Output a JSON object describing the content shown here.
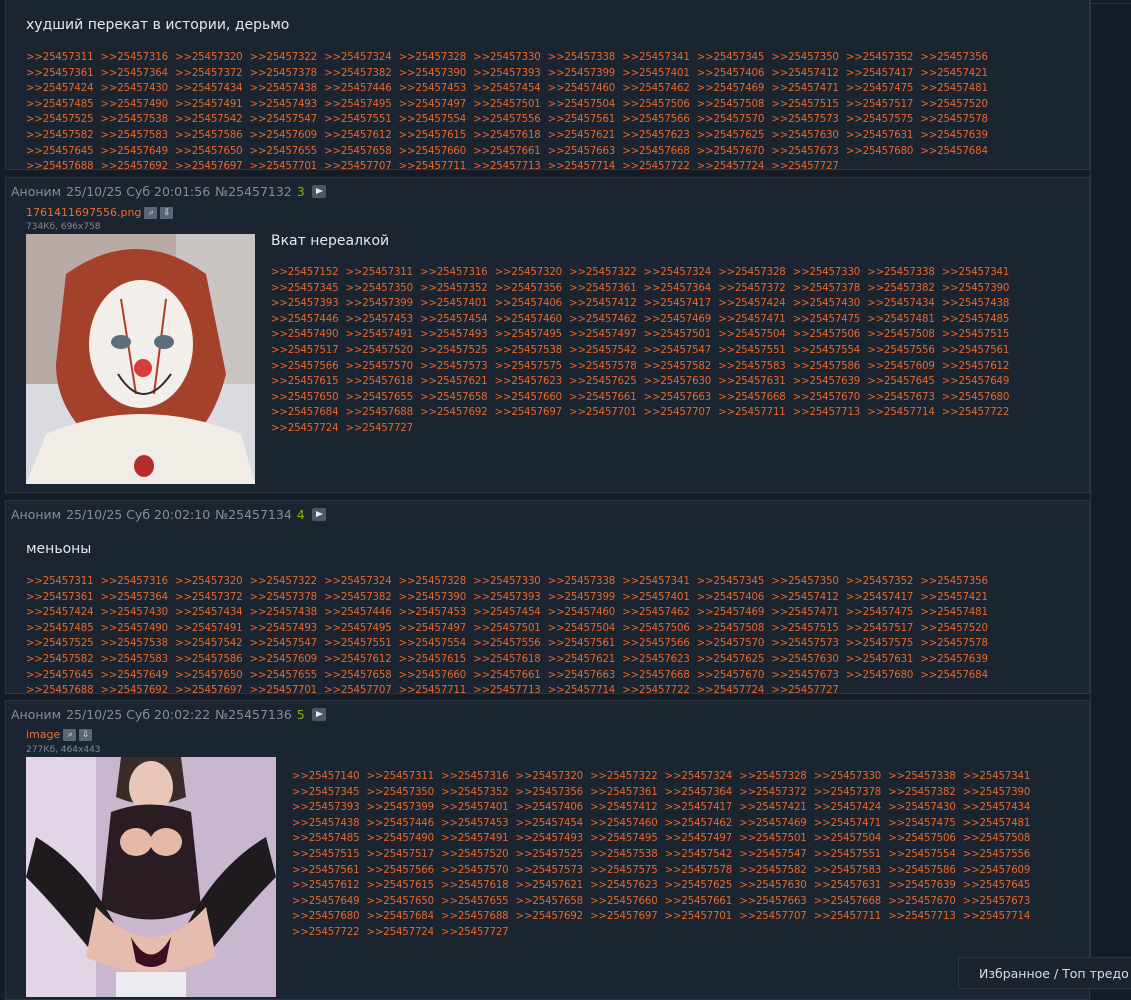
{
  "posts": [
    {
      "title": "худший перекат в истории, дерьмо",
      "links": [
        ">>25457311",
        ">>25457316",
        ">>25457320",
        ">>25457322",
        ">>25457324",
        ">>25457328",
        ">>25457330",
        ">>25457338",
        ">>25457341",
        ">>25457345",
        ">>25457350",
        ">>25457352",
        ">>25457356",
        ">>25457361",
        ">>25457364",
        ">>25457372",
        ">>25457378",
        ">>25457382",
        ">>25457390",
        ">>25457393",
        ">>25457399",
        ">>25457401",
        ">>25457406",
        ">>25457412",
        ">>25457417",
        ">>25457421",
        ">>25457424",
        ">>25457430",
        ">>25457434",
        ">>25457438",
        ">>25457446",
        ">>25457453",
        ">>25457454",
        ">>25457460",
        ">>25457462",
        ">>25457469",
        ">>25457471",
        ">>25457475",
        ">>25457481",
        ">>25457485",
        ">>25457490",
        ">>25457491",
        ">>25457493",
        ">>25457495",
        ">>25457497",
        ">>25457501",
        ">>25457504",
        ">>25457506",
        ">>25457508",
        ">>25457515",
        ">>25457517",
        ">>25457520",
        ">>25457525",
        ">>25457538",
        ">>25457542",
        ">>25457547",
        ">>25457551",
        ">>25457554",
        ">>25457556",
        ">>25457561",
        ">>25457566",
        ">>25457570",
        ">>25457573",
        ">>25457575",
        ">>25457578",
        ">>25457582",
        ">>25457583",
        ">>25457586",
        ">>25457609",
        ">>25457612",
        ">>25457615",
        ">>25457618",
        ">>25457621",
        ">>25457623",
        ">>25457625",
        ">>25457630",
        ">>25457631",
        ">>25457639",
        ">>25457645",
        ">>25457649",
        ">>25457650",
        ">>25457655",
        ">>25457658",
        ">>25457660",
        ">>25457661",
        ">>25457663",
        ">>25457668",
        ">>25457670",
        ">>25457673",
        ">>25457680",
        ">>25457684",
        ">>25457688",
        ">>25457692",
        ">>25457697",
        ">>25457701",
        ">>25457707",
        ">>25457711",
        ">>25457713",
        ">>25457714",
        ">>25457722",
        ">>25457724",
        ">>25457727"
      ]
    },
    {
      "author": "Аноним",
      "date": "25/10/25 Суб 20:01:56",
      "number": "№25457132",
      "replies": "3",
      "file_name": "1761411697556.png",
      "file_meta": "734Кб, 696x758",
      "title": "Вкат нереалкой",
      "links": [
        ">>25457152",
        ">>25457311",
        ">>25457316",
        ">>25457320",
        ">>25457322",
        ">>25457324",
        ">>25457328",
        ">>25457330",
        ">>25457338",
        ">>25457341",
        ">>25457345",
        ">>25457350",
        ">>25457352",
        ">>25457356",
        ">>25457361",
        ">>25457364",
        ">>25457372",
        ">>25457378",
        ">>25457382",
        ">>25457390",
        ">>25457393",
        ">>25457399",
        ">>25457401",
        ">>25457406",
        ">>25457412",
        ">>25457417",
        ">>25457424",
        ">>25457430",
        ">>25457434",
        ">>25457438",
        ">>25457446",
        ">>25457453",
        ">>25457454",
        ">>25457460",
        ">>25457462",
        ">>25457469",
        ">>25457471",
        ">>25457475",
        ">>25457481",
        ">>25457485",
        ">>25457490",
        ">>25457491",
        ">>25457493",
        ">>25457495",
        ">>25457497",
        ">>25457501",
        ">>25457504",
        ">>25457506",
        ">>25457508",
        ">>25457515",
        ">>25457517",
        ">>25457520",
        ">>25457525",
        ">>25457538",
        ">>25457542",
        ">>25457547",
        ">>25457551",
        ">>25457554",
        ">>25457556",
        ">>25457561",
        ">>25457566",
        ">>25457570",
        ">>25457573",
        ">>25457575",
        ">>25457578",
        ">>25457582",
        ">>25457583",
        ">>25457586",
        ">>25457609",
        ">>25457612",
        ">>25457615",
        ">>25457618",
        ">>25457621",
        ">>25457623",
        ">>25457625",
        ">>25457630",
        ">>25457631",
        ">>25457639",
        ">>25457645",
        ">>25457649",
        ">>25457650",
        ">>25457655",
        ">>25457658",
        ">>25457660",
        ">>25457661",
        ">>25457663",
        ">>25457668",
        ">>25457670",
        ">>25457673",
        ">>25457680",
        ">>25457684",
        ">>25457688",
        ">>25457692",
        ">>25457697",
        ">>25457701",
        ">>25457707",
        ">>25457711",
        ">>25457713",
        ">>25457714",
        ">>25457722",
        ">>25457724",
        ">>25457727"
      ]
    },
    {
      "author": "Аноним",
      "date": "25/10/25 Суб 20:02:10",
      "number": "№25457134",
      "replies": "4",
      "title": "меньоны",
      "links": [
        ">>25457311",
        ">>25457316",
        ">>25457320",
        ">>25457322",
        ">>25457324",
        ">>25457328",
        ">>25457330",
        ">>25457338",
        ">>25457341",
        ">>25457345",
        ">>25457350",
        ">>25457352",
        ">>25457356",
        ">>25457361",
        ">>25457364",
        ">>25457372",
        ">>25457378",
        ">>25457382",
        ">>25457390",
        ">>25457393",
        ">>25457399",
        ">>25457401",
        ">>25457406",
        ">>25457412",
        ">>25457417",
        ">>25457421",
        ">>25457424",
        ">>25457430",
        ">>25457434",
        ">>25457438",
        ">>25457446",
        ">>25457453",
        ">>25457454",
        ">>25457460",
        ">>25457462",
        ">>25457469",
        ">>25457471",
        ">>25457475",
        ">>25457481",
        ">>25457485",
        ">>25457490",
        ">>25457491",
        ">>25457493",
        ">>25457495",
        ">>25457497",
        ">>25457501",
        ">>25457504",
        ">>25457506",
        ">>25457508",
        ">>25457515",
        ">>25457517",
        ">>25457520",
        ">>25457525",
        ">>25457538",
        ">>25457542",
        ">>25457547",
        ">>25457551",
        ">>25457554",
        ">>25457556",
        ">>25457561",
        ">>25457566",
        ">>25457570",
        ">>25457573",
        ">>25457575",
        ">>25457578",
        ">>25457582",
        ">>25457583",
        ">>25457586",
        ">>25457609",
        ">>25457612",
        ">>25457615",
        ">>25457618",
        ">>25457621",
        ">>25457623",
        ">>25457625",
        ">>25457630",
        ">>25457631",
        ">>25457639",
        ">>25457645",
        ">>25457649",
        ">>25457650",
        ">>25457655",
        ">>25457658",
        ">>25457660",
        ">>25457661",
        ">>25457663",
        ">>25457668",
        ">>25457670",
        ">>25457673",
        ">>25457680",
        ">>25457684",
        ">>25457688",
        ">>25457692",
        ">>25457697",
        ">>25457701",
        ">>25457707",
        ">>25457711",
        ">>25457713",
        ">>25457714",
        ">>25457722",
        ">>25457724",
        ">>25457727"
      ]
    },
    {
      "author": "Аноним",
      "date": "25/10/25 Суб 20:02:22",
      "number": "№25457136",
      "replies": "5",
      "file_name": "image",
      "file_meta": "277Кб, 464x443",
      "links": [
        ">>25457140",
        ">>25457311",
        ">>25457316",
        ">>25457320",
        ">>25457322",
        ">>25457324",
        ">>25457328",
        ">>25457330",
        ">>25457338",
        ">>25457341",
        ">>25457345",
        ">>25457350",
        ">>25457352",
        ">>25457356",
        ">>25457361",
        ">>25457364",
        ">>25457372",
        ">>25457378",
        ">>25457382",
        ">>25457390",
        ">>25457393",
        ">>25457399",
        ">>25457401",
        ">>25457406",
        ">>25457412",
        ">>25457417",
        ">>25457421",
        ">>25457424",
        ">>25457430",
        ">>25457434",
        ">>25457438",
        ">>25457446",
        ">>25457453",
        ">>25457454",
        ">>25457460",
        ">>25457462",
        ">>25457469",
        ">>25457471",
        ">>25457475",
        ">>25457481",
        ">>25457485",
        ">>25457490",
        ">>25457491",
        ">>25457493",
        ">>25457495",
        ">>25457497",
        ">>25457501",
        ">>25457504",
        ">>25457506",
        ">>25457508",
        ">>25457515",
        ">>25457517",
        ">>25457520",
        ">>25457525",
        ">>25457538",
        ">>25457542",
        ">>25457547",
        ">>25457551",
        ">>25457554",
        ">>25457556",
        ">>25457561",
        ">>25457566",
        ">>25457570",
        ">>25457573",
        ">>25457575",
        ">>25457578",
        ">>25457582",
        ">>25457583",
        ">>25457586",
        ">>25457609",
        ">>25457612",
        ">>25457615",
        ">>25457618",
        ">>25457621",
        ">>25457623",
        ">>25457625",
        ">>25457630",
        ">>25457631",
        ">>25457639",
        ">>25457645",
        ">>25457649",
        ">>25457650",
        ">>25457655",
        ">>25457658",
        ">>25457660",
        ">>25457661",
        ">>25457663",
        ">>25457668",
        ">>25457670",
        ">>25457673",
        ">>25457680",
        ">>25457684",
        ">>25457688",
        ">>25457692",
        ">>25457697",
        ">>25457701",
        ">>25457707",
        ">>25457711",
        ">>25457713",
        ">>25457714",
        ">>25457722",
        ">>25457724",
        ">>25457727"
      ]
    }
  ],
  "favorites_bar": {
    "label": "Избранное / Топ тредо"
  },
  "icons": {
    "play": "play-icon",
    "search": "search-icon",
    "download": "download-icon"
  },
  "colors": {
    "background": "#151c25",
    "post_bg": "#1b2532",
    "link": "#e8672a",
    "replies": "#7fba00"
  }
}
